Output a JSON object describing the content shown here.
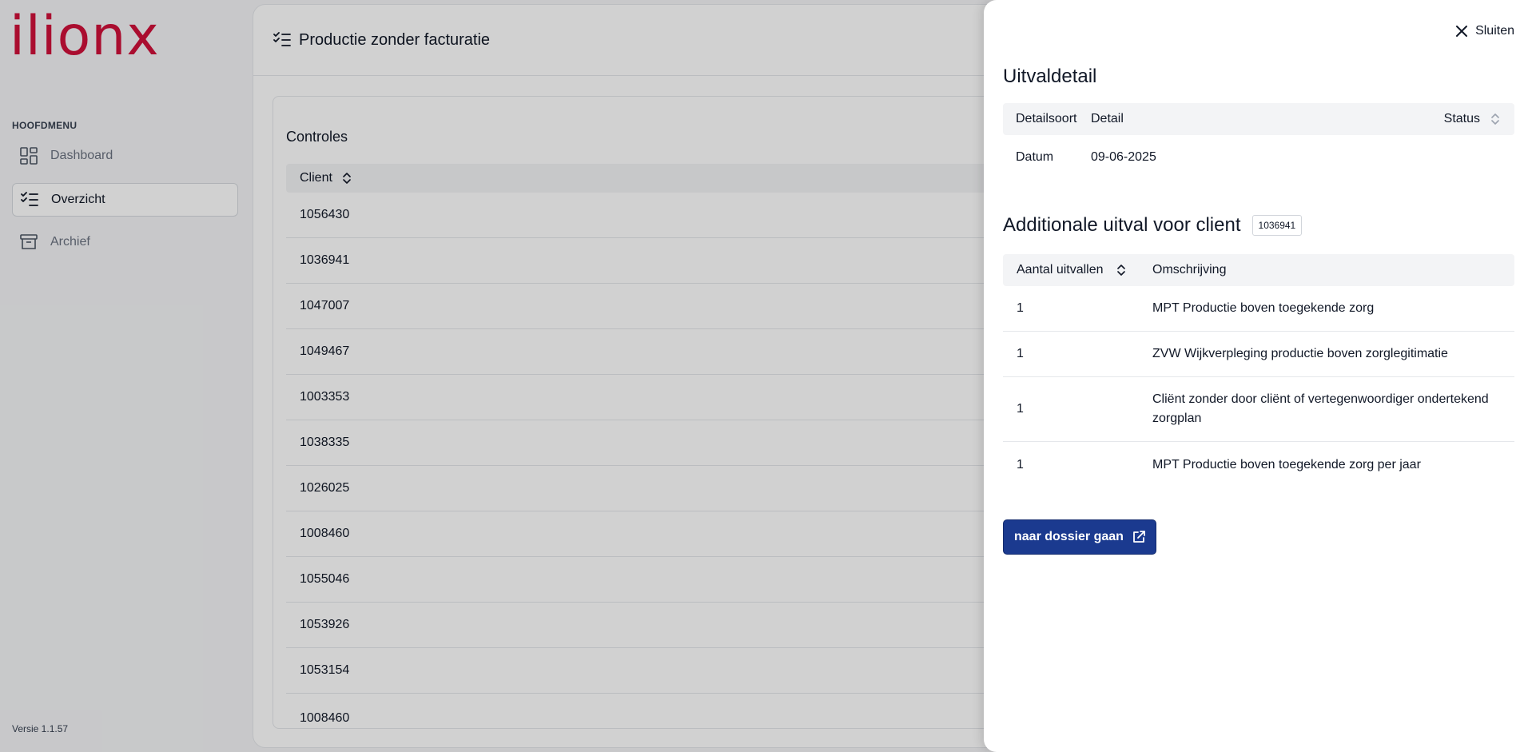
{
  "sidebar": {
    "logo": "ilionx",
    "menu_heading": "HOOFDMENU",
    "items": [
      {
        "label": "Dashboard"
      },
      {
        "label": "Overzicht"
      },
      {
        "label": "Archief"
      }
    ],
    "version": "Versie 1.1.57"
  },
  "header": {
    "title": "Productie zonder facturatie"
  },
  "main": {
    "card_title": "Controles",
    "client_column": "Client",
    "clients": [
      "1056430",
      "1036941",
      "1047007",
      "1049467",
      "1003353",
      "1038335",
      "1026025",
      "1008460",
      "1055046",
      "1053926",
      "1053154",
      "1008460"
    ]
  },
  "drawer": {
    "close_label": "Sluiten",
    "title": "Uitvaldetail",
    "detail_columns": [
      "Detailsoort",
      "Detail",
      "Status"
    ],
    "detail_rows": [
      {
        "soort": "Datum",
        "detail": "09-06-2025"
      }
    ],
    "additional_title": "Additionale uitval voor client",
    "client_badge": "1036941",
    "additional_columns": [
      "Aantal uitvallen",
      "Omschrijving"
    ],
    "additional_rows": [
      {
        "count": "1",
        "description": "MPT Productie boven toegekende zorg"
      },
      {
        "count": "1",
        "description": "ZVW Wijkverpleging productie boven zorglegitimatie"
      },
      {
        "count": "1",
        "description": "Cliënt zonder door cliënt of vertegenwoordiger ondertekend zorgplan"
      },
      {
        "count": "1",
        "description": "MPT Productie boven toegekende zorg per jaar"
      }
    ],
    "dossier_button": "naar dossier gaan"
  },
  "colors": {
    "brand": "#d0103a",
    "primary_button": "#1b3a8f"
  }
}
